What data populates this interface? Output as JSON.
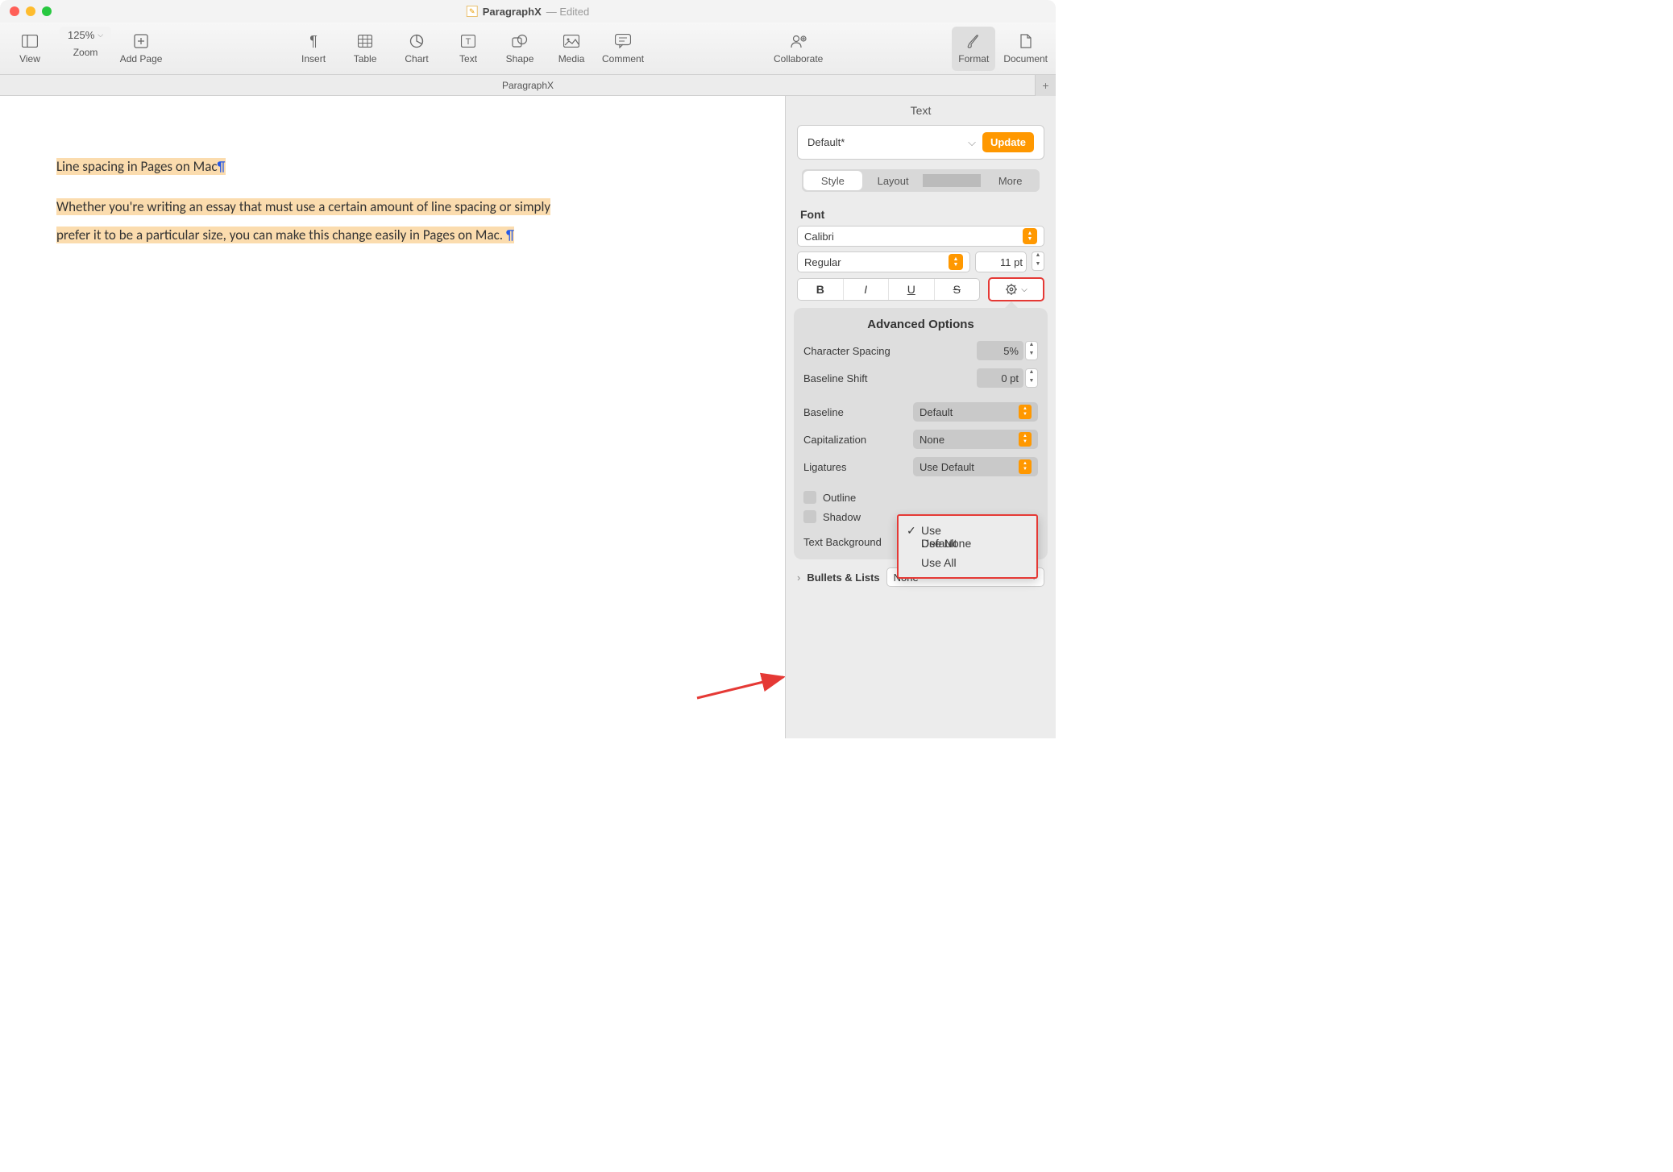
{
  "window": {
    "doc_name": "ParagraphX",
    "edited_label": "— Edited"
  },
  "toolbar": {
    "view": "View",
    "zoom_label": "Zoom",
    "zoom_value": "125%",
    "add_page": "Add Page",
    "insert": "Insert",
    "table": "Table",
    "chart": "Chart",
    "text": "Text",
    "shape": "Shape",
    "media": "Media",
    "comment": "Comment",
    "collaborate": "Collaborate",
    "format": "Format",
    "document": "Document"
  },
  "tabs": {
    "name": "ParagraphX"
  },
  "document": {
    "line1": "Line spacing in Pages on Mac",
    "line2": "Whether you're writing an essay that must use a certain amount of line spacing or simply prefer it to be a particular size, you can make this change easily in Pages on Mac. "
  },
  "inspector": {
    "title": "Text",
    "style_name": "Default*",
    "update": "Update",
    "tabs": {
      "style": "Style",
      "layout": "Layout",
      "more": "More"
    },
    "font_label": "Font",
    "font_family": "Calibri",
    "font_style": "Regular",
    "font_size": "11 pt",
    "advanced": {
      "title": "Advanced Options",
      "char_spacing_label": "Character Spacing",
      "char_spacing_value": "5%",
      "baseline_shift_label": "Baseline Shift",
      "baseline_shift_value": "0 pt",
      "baseline_label": "Baseline",
      "baseline_value": "Default",
      "capitalization_label": "Capitalization",
      "capitalization_value": "None",
      "ligatures_label": "Ligatures",
      "ligatures_value": "Use Default",
      "outline_label": "Outline",
      "shadow_label": "Shadow",
      "text_bg_label": "Text Background"
    },
    "ligatures_menu": {
      "opt1": "Use Default",
      "opt2": "Use None",
      "opt3": "Use All"
    },
    "bullets_label": "Bullets & Lists",
    "bullets_value": "None"
  }
}
